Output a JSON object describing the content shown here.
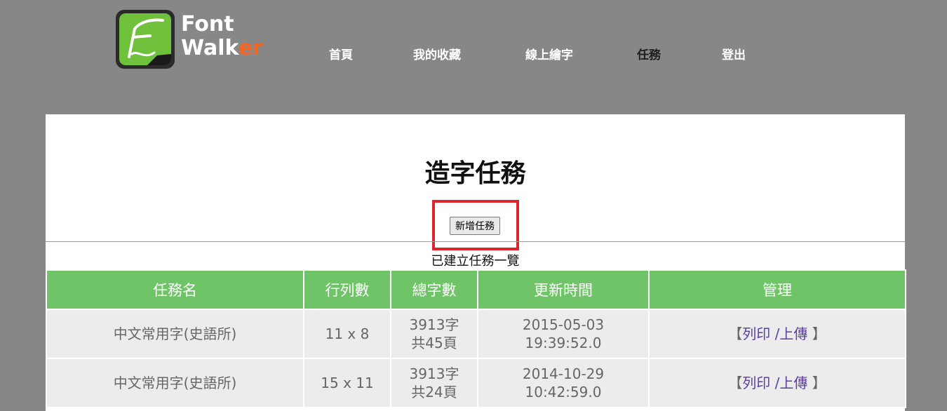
{
  "logo": {
    "line1": "Font",
    "line2_white": "Walk",
    "line2_orange": "er"
  },
  "nav": [
    {
      "label": "首頁",
      "active": false
    },
    {
      "label": "我的收藏",
      "active": false
    },
    {
      "label": "線上繪字",
      "active": false
    },
    {
      "label": "任務",
      "active": true
    },
    {
      "label": "登出",
      "active": false
    }
  ],
  "page": {
    "title": "造字任務",
    "add_button": "新增任務",
    "list_caption": "已建立任務一覽"
  },
  "table": {
    "headers": [
      "任務名",
      "行列數",
      "總字數",
      "更新時間",
      "管理"
    ],
    "rows": [
      {
        "name": "中文常用字(史語所)",
        "grid": "11 x 8",
        "count_line1": "3913字",
        "count_line2": "共45頁",
        "date": "2015-05-03",
        "time": "19:39:52.0",
        "open": "【",
        "print": "列印",
        "sep": " /",
        "upload": "上傳",
        "close": " 】"
      },
      {
        "name": "中文常用字(史語所)",
        "grid": "15 x 11",
        "count_line1": "3913字",
        "count_line2": "共24頁",
        "date": "2014-10-29",
        "time": "10:42:59.0",
        "open": "【",
        "print": "列印",
        "sep": " /",
        "upload": "上傳",
        "close": " 】"
      }
    ]
  },
  "colors": {
    "background": "#878787",
    "header_green": "#6ec466",
    "logo_orange": "#f26522",
    "highlight_red": "#e0242c",
    "link_purple": "#5a3fa0"
  }
}
